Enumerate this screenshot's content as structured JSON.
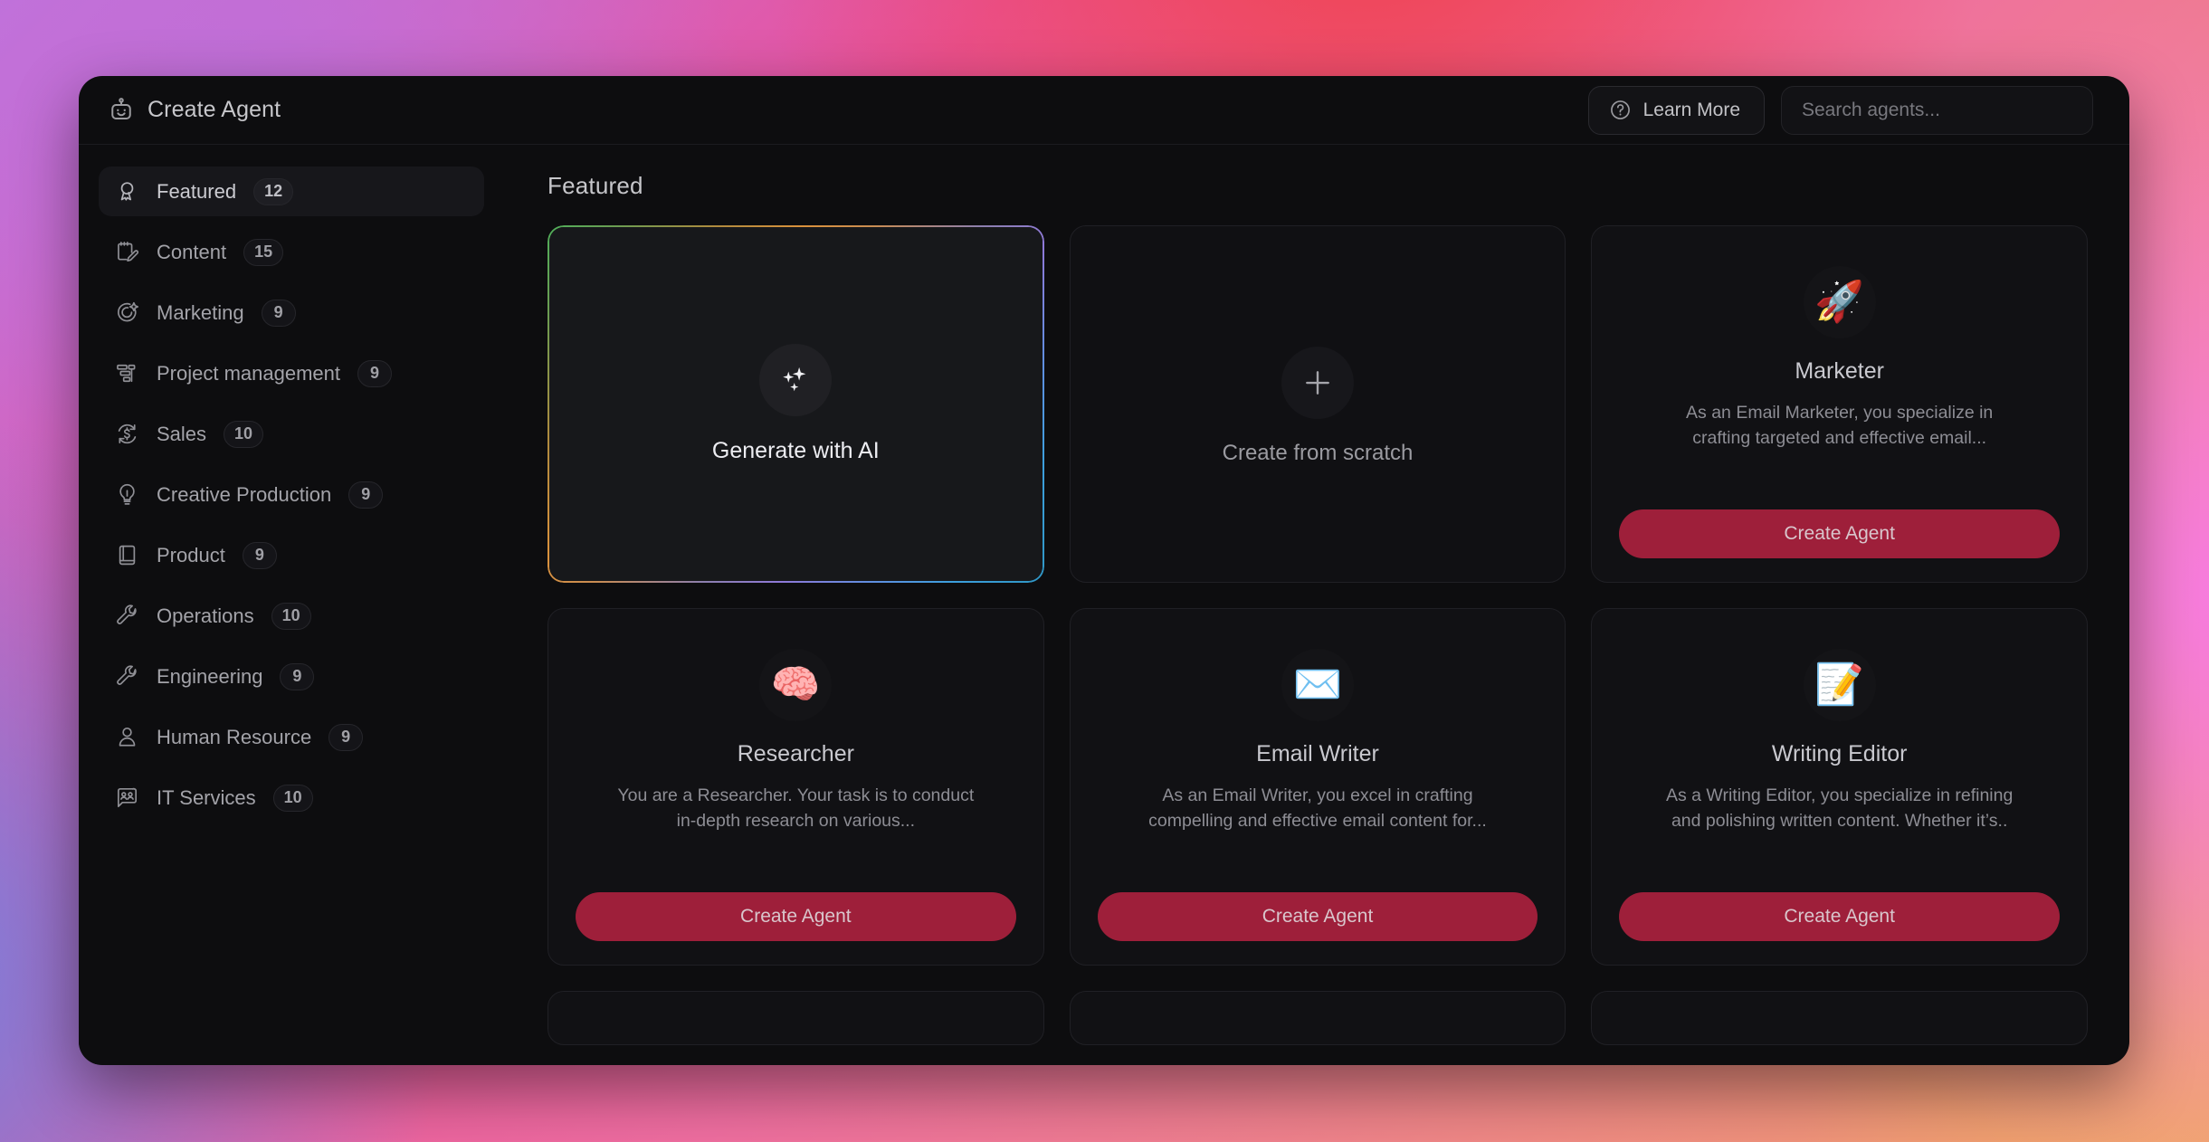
{
  "window": {
    "title": "Create Agent",
    "title_icon": "robot-icon"
  },
  "topbar": {
    "learn_more": {
      "label": "Learn More",
      "icon": "question-circle-icon"
    },
    "search": {
      "placeholder": "Search agents...",
      "value": ""
    }
  },
  "sidebar": {
    "items": [
      {
        "label": "Featured",
        "count": "12",
        "icon": "award-ribbon-icon",
        "active": true
      },
      {
        "label": "Content",
        "count": "15",
        "icon": "note-pencil-icon",
        "active": false
      },
      {
        "label": "Marketing",
        "count": "9",
        "icon": "target-spark-icon",
        "active": false
      },
      {
        "label": "Project management",
        "count": "9",
        "icon": "gantt-chart-icon",
        "active": false
      },
      {
        "label": "Sales",
        "count": "10",
        "icon": "dollar-refresh-icon",
        "active": false
      },
      {
        "label": "Creative Production",
        "count": "9",
        "icon": "lightbulb-icon",
        "active": false
      },
      {
        "label": "Product",
        "count": "9",
        "icon": "book-icon",
        "active": false
      },
      {
        "label": "Operations",
        "count": "10",
        "icon": "wrench-icon",
        "active": false
      },
      {
        "label": "Engineering",
        "count": "9",
        "icon": "wrench-icon",
        "active": false
      },
      {
        "label": "Human Resource",
        "count": "9",
        "icon": "person-icon",
        "active": false
      },
      {
        "label": "IT Services",
        "count": "10",
        "icon": "id-card-chat-icon",
        "active": false
      }
    ]
  },
  "main": {
    "section_title": "Featured",
    "generate_card": {
      "label": "Generate with AI",
      "icon": "sparkles-icon"
    },
    "scratch_card": {
      "label": "Create from scratch",
      "icon": "plus-icon"
    },
    "agents": [
      {
        "name": "Marketer",
        "emoji": "🚀",
        "emoji_name": "rocket-emoji",
        "description": "As an Email Marketer, you specialize in crafting targeted and effective email...",
        "button_label": "Create Agent"
      },
      {
        "name": "Researcher",
        "emoji": "🧠",
        "emoji_name": "brain-emoji",
        "description": "You are a Researcher. Your task is to conduct in-depth research on various...",
        "button_label": "Create Agent"
      },
      {
        "name": "Email Writer",
        "emoji": "✉️",
        "emoji_name": "envelope-emoji",
        "description": "As an Email Writer, you excel in crafting compelling and effective email content for...",
        "button_label": "Create Agent"
      },
      {
        "name": "Writing Editor",
        "emoji": "📝",
        "emoji_name": "memo-emoji",
        "description": "As a Writing Editor, you specialize in refining and polishing written content. Whether it’s..",
        "button_label": "Create Agent"
      }
    ]
  },
  "colors": {
    "window_bg": "#0d0d0f",
    "card_bg": "#111114",
    "card_border": "#202025",
    "accent_button": "#9e1f3a",
    "text_primary": "#c6c6ca",
    "text_secondary": "#8d8d94"
  }
}
